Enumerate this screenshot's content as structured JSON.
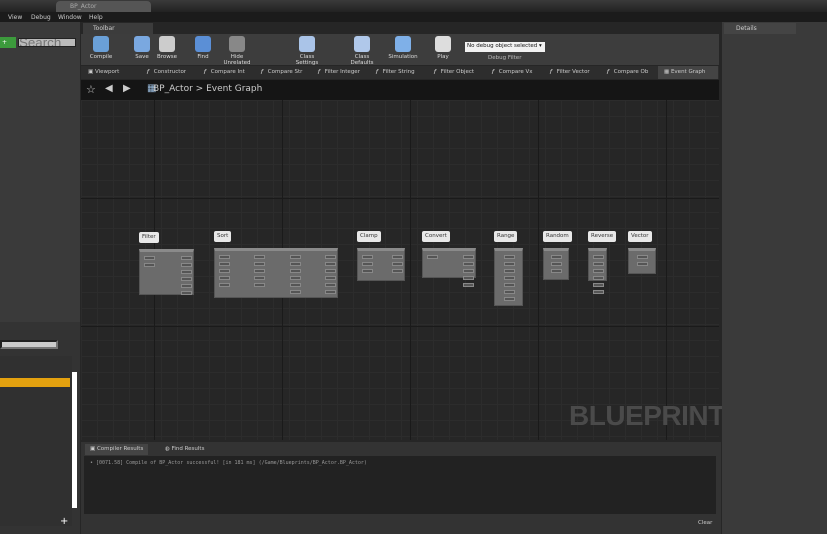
{
  "window": {
    "tab_title": "BP_Actor"
  },
  "menu": [
    "View",
    "Debug",
    "Window",
    "Help"
  ],
  "left": {
    "add_label": "+",
    "search_placeholder": "Search"
  },
  "toolbar": {
    "tab": "Toolbar",
    "buttons": [
      {
        "label": "Compile",
        "icon": "compile-gear-icon",
        "color": "#6aa0d8"
      },
      {
        "label": "Save",
        "icon": "save-disk-icon",
        "color": "#7aa8e0"
      },
      {
        "label": "Browse",
        "icon": "browse-magnifier-icon",
        "color": "#cccccc"
      },
      {
        "label": "Find",
        "icon": "find-binoculars-icon",
        "color": "#5b8fd6"
      },
      {
        "label": "Hide Unrelated",
        "icon": "hide-unrelated-icon",
        "color": "#888888"
      },
      {
        "label": "Class Settings",
        "icon": "class-settings-icon",
        "color": "#aac4e8"
      },
      {
        "label": "Class Defaults",
        "icon": "class-defaults-icon",
        "color": "#b0c8ea"
      },
      {
        "label": "Simulation",
        "icon": "simulation-icon",
        "color": "#7fb0e8"
      },
      {
        "label": "Play",
        "icon": "play-icon",
        "color": "#dddddd"
      }
    ],
    "debug_filter_value": "No debug object selected",
    "debug_filter_label": "Debug Filter"
  },
  "function_tabs": [
    "Viewport",
    "Constructor",
    "Compare Int",
    "Compare Str",
    "Filter Integer",
    "Filter String",
    "Filter Object",
    "Compare Vx",
    "Filter Vector",
    "Compare Ob",
    "Event Graph"
  ],
  "breadcrumb": {
    "root": "BP_Actor",
    "sep": ">",
    "current": "Event Graph"
  },
  "graph": {
    "watermark": "BLUEPRINT",
    "nodes": [
      {
        "label": "Filter",
        "pins": [
          2,
          6
        ]
      },
      {
        "label": "Sort",
        "pins": [
          5,
          5,
          6,
          6
        ]
      },
      {
        "label": "Clamp",
        "pins": [
          3,
          3
        ]
      },
      {
        "label": "Convert",
        "pins": [
          1,
          5
        ]
      },
      {
        "label": "Range",
        "pins": [
          7
        ]
      },
      {
        "label": "Random",
        "pins": [
          3
        ]
      },
      {
        "label": "Reverse",
        "pins": [
          6
        ]
      },
      {
        "label": "Vector",
        "pins": [
          2
        ]
      }
    ]
  },
  "bottom": {
    "tabs": [
      "Compiler Results",
      "Find Results"
    ],
    "log": "• [0071.58] Compile of BP_Actor successful! [in 181 ms] (/Game/Blueprints/BP_Actor.BP_Actor)",
    "clear": "Clear"
  },
  "details": {
    "tab": "Details"
  }
}
